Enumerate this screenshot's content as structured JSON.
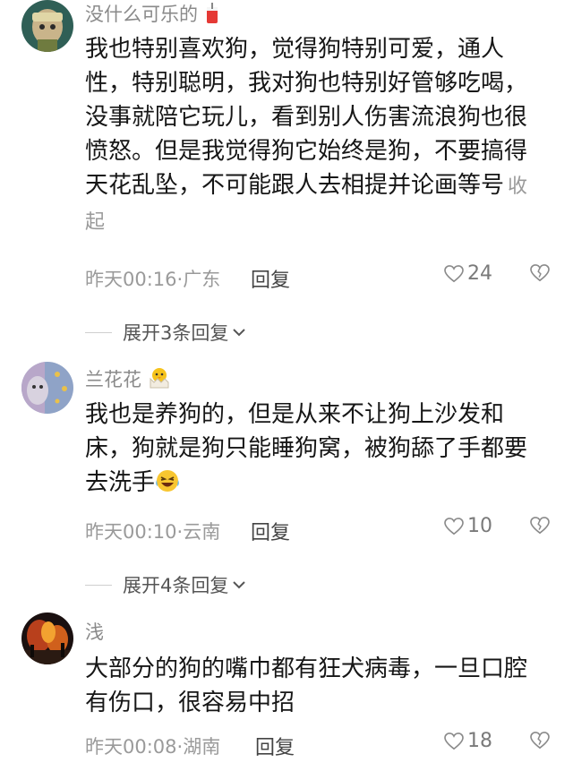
{
  "comments": [
    {
      "username": "没什么可乐的",
      "text": "我也特别喜欢狗，觉得狗特别可爱，通人性，特别聪明，我对狗也特别好管够吃喝，没事就陪它玩儿，看到别人伤害流浪狗也很愤怒。但是我觉得狗它始终是狗，不要搞得天花乱坠，不可能跟人去相提并论画等号",
      "collapse_label": "收起",
      "meta": "昨天00:16·广东",
      "reply_label": "回复",
      "likes": "24",
      "expand_label": "展开3条回复"
    },
    {
      "username": "兰花花",
      "text": "我也是养狗的，但是从来不让狗上沙发和床，狗就是狗只能睡狗窝，被狗舔了手都要去洗手",
      "meta": "昨天00:10·云南",
      "reply_label": "回复",
      "likes": "10",
      "expand_label": "展开4条回复"
    },
    {
      "username": "浅",
      "text": "大部分的狗的嘴巾都有狂犬病毒，一旦口腔有伤口，很容易中招",
      "meta": "昨天00:08·湖南",
      "reply_label": "回复",
      "likes": "18"
    }
  ],
  "icons": {
    "like": "heart-outline-icon",
    "dislike": "broken-heart-icon",
    "chevron": "chevron-down-icon",
    "cola": "cola-cup-emoji",
    "chick": "hatching-chick-emoji",
    "laugh": "laughing-tears-emoji"
  },
  "colors": {
    "text": "#161616",
    "muted": "#9a9a9a"
  }
}
